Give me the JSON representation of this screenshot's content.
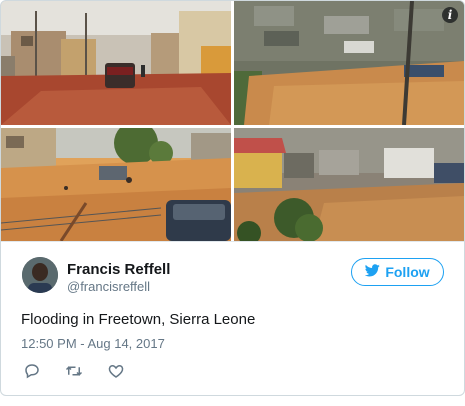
{
  "tweet": {
    "author_name": "Francis Reffell",
    "author_handle": "@francisreffell",
    "follow_label": "Follow",
    "text": "Flooding in Freetown, Sierra Leone",
    "timestamp": "12:50 PM - Aug 14, 2017"
  },
  "media": {
    "info_glyph": "i"
  },
  "icons": [
    "info-icon",
    "twitter-bird-icon",
    "reply-icon",
    "retweet-icon",
    "like-icon"
  ],
  "colors": {
    "accent": "#1da1f2",
    "text": "#14171a",
    "muted": "#657786",
    "border": "#cfd9de"
  }
}
